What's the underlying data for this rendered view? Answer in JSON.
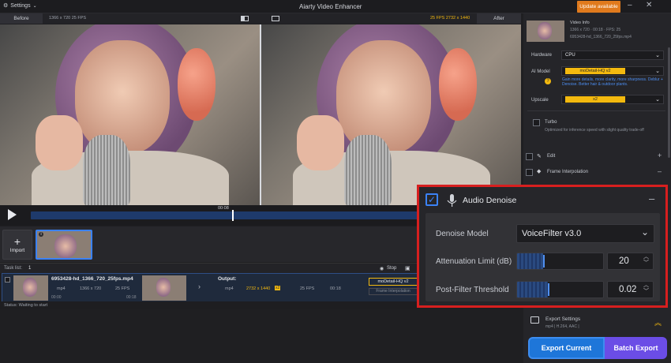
{
  "titlebar": {
    "settings": "Settings",
    "title": "Aiarty Video Enhancer",
    "update": "Update available"
  },
  "compare": {
    "before": "Before",
    "before_meta": "1366 x 720  25 FPS",
    "after": "After",
    "after_meta": "25 FPS  2732 x 1440"
  },
  "timeline": {
    "timecode": "00:08",
    "progress": 0.52
  },
  "import": {
    "label": "Import"
  },
  "tasks": {
    "label": "Task list:",
    "count": "1",
    "stop": "Stop",
    "filename": "6953428-hd_1366_720_25fps.mp4",
    "in_format": "mp4",
    "in_res": "1366 x 720",
    "in_fps": "25 FPS",
    "in_start": "00:00",
    "in_end": "00:18",
    "output": "Output:",
    "out_format": "mp4",
    "out_res": "2732 x 1440",
    "out_scale": "x2",
    "out_fps": "25 FPS",
    "out_dur": "00:18",
    "model": "moDetail-HQ  v2",
    "interp": "Frame Interpolation",
    "status": "Status: Waiting to start"
  },
  "right": {
    "video_info": "Video Info",
    "info_line1": "1366 x 720 · 00:18 · FPS: 25",
    "info_line2": "6953428-hd_1366_720_25fps.mp4",
    "hardware_label": "Hardware",
    "hardware": "CPU",
    "aimodel_label": "AI Model",
    "aimodel": "moDetail-HQ  v2",
    "aimodel_desc": "Gain more details, more clarity, more sharpness. Deblur + Denoise. Better hair & outdoor plants.",
    "upscale_label": "Upscale",
    "upscale": "x2",
    "turbo": "Turbo",
    "turbo_desc": "Optimized for inference speed with slight quality trade-off",
    "edit": "Edit",
    "frame_interp": "Frame Interpolation",
    "export_settings": "Export Settings",
    "export_meta": "mp4 | H.264, AAC |",
    "export_current": "Export Current",
    "batch_export": "Batch Export"
  },
  "audio_denoise": {
    "title": "Audio Denoise",
    "model_label": "Denoise Model",
    "model_value": "VoiceFilter v3.0",
    "atten_label": "Attenuation Limit (dB)",
    "atten_value": "20",
    "atten_level": 0.3,
    "post_label": "Post-Filter Threshold",
    "post_value": "0.02",
    "post_level": 0.36
  },
  "colors": {
    "accent": "#1e76d9",
    "batch": "#6b4de6",
    "highlight": "#d71f1f",
    "model_bar": "#f3b90f",
    "update": "#e07a1d"
  }
}
